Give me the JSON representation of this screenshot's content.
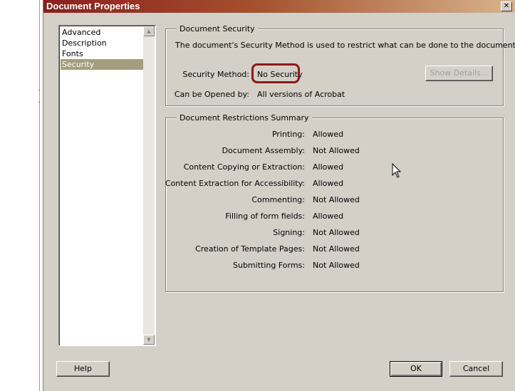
{
  "window": {
    "title": "Document Properties",
    "close_symbol": "✕"
  },
  "sidebar": {
    "items": [
      {
        "label": "Advanced",
        "selected": false
      },
      {
        "label": "Description",
        "selected": false
      },
      {
        "label": "Fonts",
        "selected": false
      },
      {
        "label": "Security",
        "selected": true
      }
    ]
  },
  "security": {
    "group_title": "Document Security",
    "description": "The document's Security Method is used to restrict what can be done to the document.",
    "method_label": "Security Method:",
    "method_value": "No Security",
    "show_details_label": "Show Details...",
    "opened_by_label": "Can be Opened by:",
    "opened_by_value": "All versions of Acrobat"
  },
  "restrictions": {
    "group_title": "Document Restrictions Summary",
    "rows": [
      {
        "label": "Printing:",
        "value": "Allowed"
      },
      {
        "label": "Document Assembly:",
        "value": "Not Allowed"
      },
      {
        "label": "Content Copying or Extraction:",
        "value": "Allowed"
      },
      {
        "label": "Content Extraction for Accessibility:",
        "value": "Allowed"
      },
      {
        "label": "Commenting:",
        "value": "Not Allowed"
      },
      {
        "label": "Filling of form fields:",
        "value": "Allowed"
      },
      {
        "label": "Signing:",
        "value": "Not Allowed"
      },
      {
        "label": "Creation of Template Pages:",
        "value": "Not Allowed"
      },
      {
        "label": "Submitting Forms:",
        "value": "Not Allowed"
      }
    ]
  },
  "footer": {
    "help_label": "Help",
    "ok_label": "OK",
    "cancel_label": "Cancel"
  },
  "colors": {
    "highlight_ring": "#8a1a1a",
    "selected_item": "#a29e7e"
  }
}
